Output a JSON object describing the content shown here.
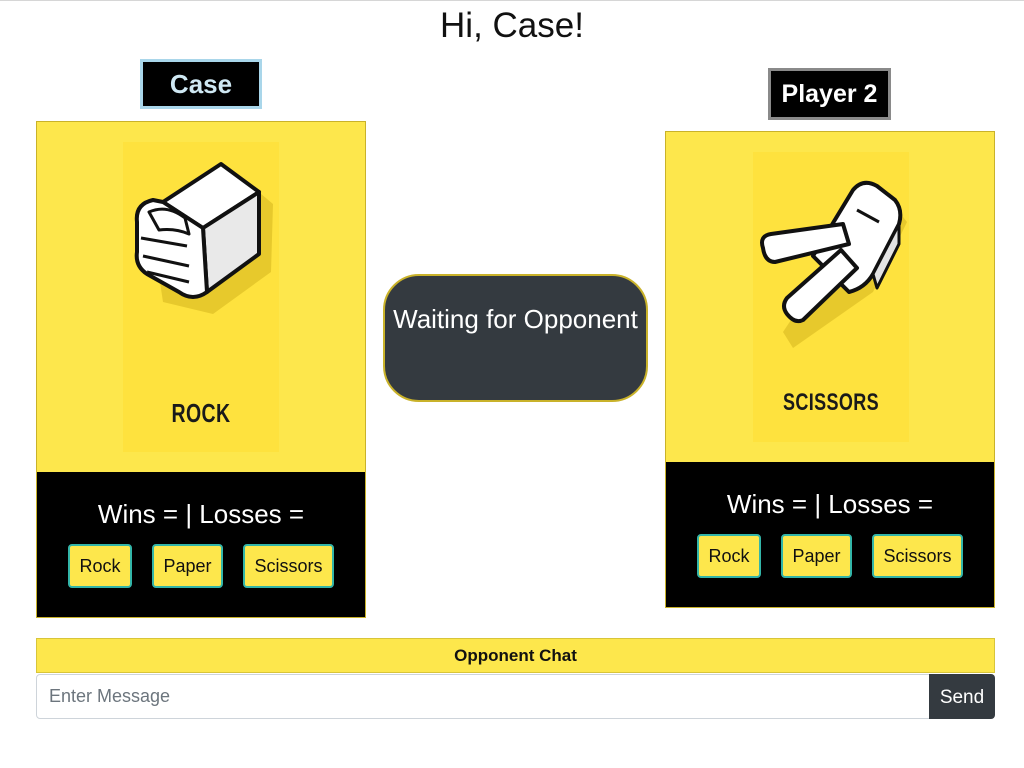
{
  "greeting": "Hi, Case!",
  "player1": {
    "name": "Case",
    "choice_label": "ROCK",
    "choice_icon": "rock-fist-icon",
    "record": "Wins = | Losses =",
    "buttons": {
      "rock": "Rock",
      "paper": "Paper",
      "scissors": "Scissors"
    }
  },
  "player2": {
    "name": "Player 2",
    "choice_label": "SCISSORS",
    "choice_icon": "scissors-hand-icon",
    "record": "Wins = | Losses =",
    "buttons": {
      "rock": "Rock",
      "paper": "Paper",
      "scissors": "Scissors"
    }
  },
  "status": {
    "message": "Waiting for Opponent"
  },
  "chat": {
    "header": "Opponent Chat",
    "input_placeholder": "Enter Message",
    "input_value": "",
    "send_label": "Send"
  },
  "colors": {
    "card_yellow": "#fde74c",
    "dark": "#343a40",
    "button_border": "#33b5a8"
  }
}
